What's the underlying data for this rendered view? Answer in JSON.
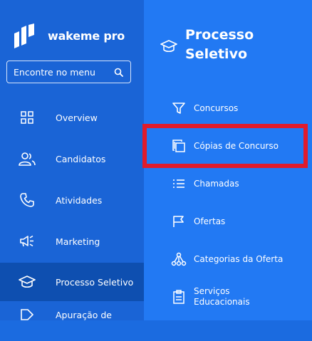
{
  "brand": {
    "name": "wakeme pro"
  },
  "search": {
    "placeholder": "Encontre no menu",
    "icon": "search-icon"
  },
  "sidebar": {
    "items": [
      {
        "label": "Overview",
        "icon": "grid-icon"
      },
      {
        "label": "Candidatos",
        "icon": "users-icon"
      },
      {
        "label": "Atividades",
        "icon": "phone-icon"
      },
      {
        "label": "Marketing",
        "icon": "megaphone-icon"
      },
      {
        "label": "Processo Seletivo",
        "icon": "graduation-cap-icon",
        "active": true
      },
      {
        "label": "Apuração de",
        "icon": "tag-icon"
      }
    ]
  },
  "submenu": {
    "title": "Processo Seletivo",
    "items": [
      {
        "label": "Concursos",
        "icon": "filter-icon"
      },
      {
        "label": "Cópias de Concurso",
        "icon": "copy-icon",
        "highlighted": true
      },
      {
        "label": "Chamadas",
        "icon": "list-icon"
      },
      {
        "label": "Ofertas",
        "icon": "flag-icon"
      },
      {
        "label": "Categorias da Oferta",
        "icon": "hierarchy-icon"
      },
      {
        "label_line1": "Serviços",
        "label_line2": "Educacionais",
        "icon": "clipboard-icon"
      }
    ]
  },
  "colors": {
    "sidebar": "#1a64d6",
    "submenu": "#2279f3",
    "active": "#0e4fb0",
    "highlight": "#e01b2c"
  }
}
